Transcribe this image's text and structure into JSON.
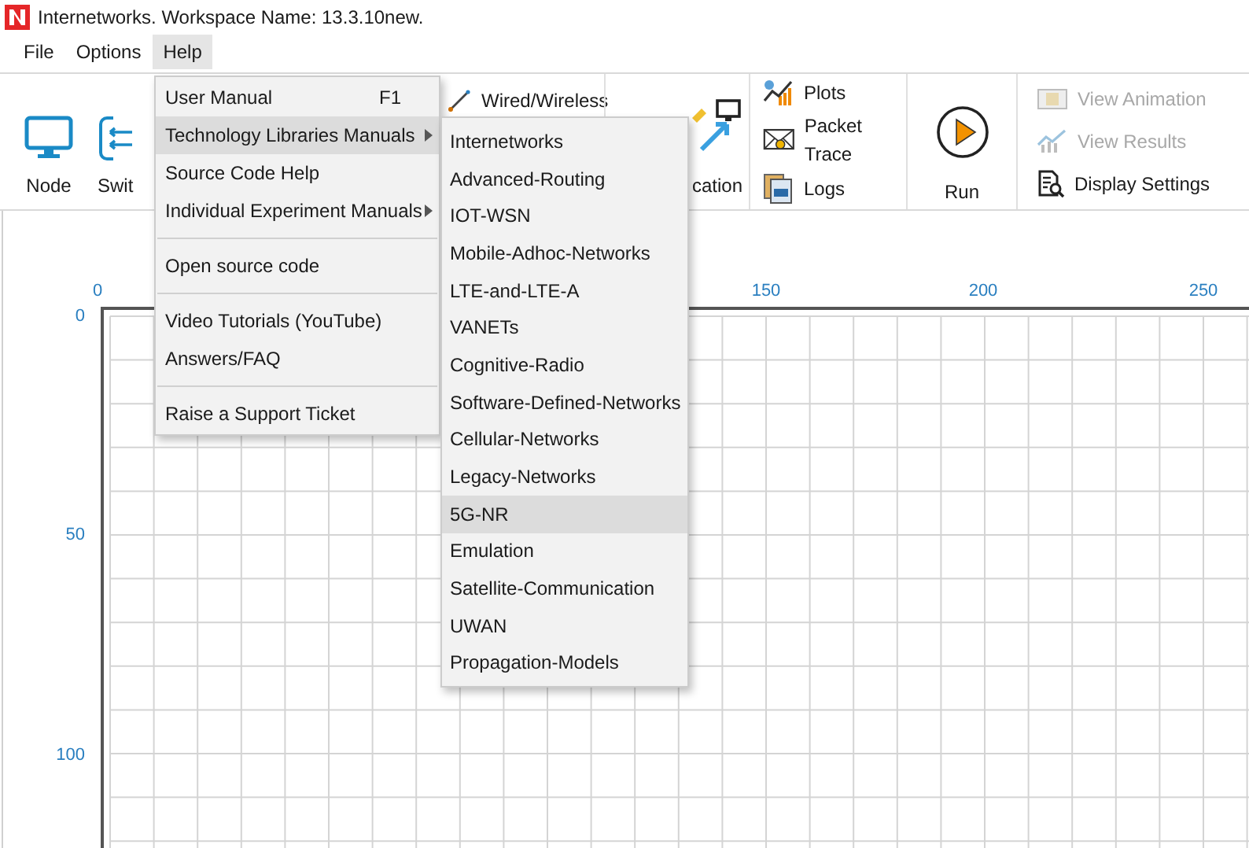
{
  "window": {
    "title": "Internetworks. Workspace Name: 13.3.10new."
  },
  "menu_bar": [
    {
      "label": "File",
      "selected": false
    },
    {
      "label": "Options",
      "selected": false
    },
    {
      "label": "Help",
      "selected": true
    }
  ],
  "ribbon": {
    "left": [
      {
        "kind": "node",
        "label": "Node"
      },
      {
        "kind": "switch",
        "label": "Swit"
      }
    ],
    "wired": {
      "label": "Wired/Wireless"
    },
    "application": {
      "label": "cation"
    },
    "tools": [
      {
        "kind": "plots",
        "label": "Plots"
      },
      {
        "kind": "packet_trace",
        "label": "Packet Trace"
      },
      {
        "kind": "logs",
        "label": "Logs"
      }
    ],
    "run": {
      "label": "Run"
    },
    "results": [
      {
        "kind": "animation",
        "label": "View Animation",
        "disabled": true
      },
      {
        "kind": "results",
        "label": "View Results",
        "disabled": true
      },
      {
        "kind": "display",
        "label": "Display Settings",
        "disabled": false
      }
    ]
  },
  "help_menu": [
    {
      "kind": "item",
      "label": "User Manual",
      "shortcut": "F1",
      "submenu": false,
      "selected": false
    },
    {
      "kind": "item",
      "label": "Technology Libraries Manuals",
      "submenu": true,
      "selected": true
    },
    {
      "kind": "item",
      "label": "Source Code Help",
      "submenu": false,
      "selected": false
    },
    {
      "kind": "item",
      "label": "Individual Experiment Manuals",
      "submenu": true,
      "selected": false
    },
    {
      "kind": "separator"
    },
    {
      "kind": "item",
      "label": "Open source code",
      "submenu": false,
      "selected": false
    },
    {
      "kind": "separator"
    },
    {
      "kind": "item",
      "label": "Video Tutorials (YouTube)",
      "submenu": false,
      "selected": false
    },
    {
      "kind": "item",
      "label": "Answers/FAQ",
      "submenu": false,
      "selected": false
    },
    {
      "kind": "separator"
    },
    {
      "kind": "item",
      "label": "Raise a Support Ticket",
      "submenu": false,
      "selected": false
    }
  ],
  "submenu": [
    {
      "label": "Internetworks",
      "selected": false
    },
    {
      "label": "Advanced-Routing",
      "selected": false
    },
    {
      "label": "IOT-WSN",
      "selected": false
    },
    {
      "label": "Mobile-Adhoc-Networks",
      "selected": false
    },
    {
      "label": "LTE-and-LTE-A",
      "selected": false
    },
    {
      "label": "VANETs",
      "selected": false
    },
    {
      "label": "Cognitive-Radio",
      "selected": false
    },
    {
      "label": "Software-Defined-Networks",
      "selected": false
    },
    {
      "label": "Cellular-Networks",
      "selected": false
    },
    {
      "label": "Legacy-Networks",
      "selected": false
    },
    {
      "label": "5G-NR",
      "selected": true
    },
    {
      "label": "Emulation",
      "selected": false
    },
    {
      "label": "Satellite-Communication",
      "selected": false
    },
    {
      "label": "UWAN",
      "selected": false
    },
    {
      "label": "Propagation-Models",
      "selected": false
    }
  ],
  "x_ruler": [
    "0",
    "150",
    "200",
    "250"
  ],
  "y_ruler": [
    "0",
    "50",
    "100"
  ]
}
